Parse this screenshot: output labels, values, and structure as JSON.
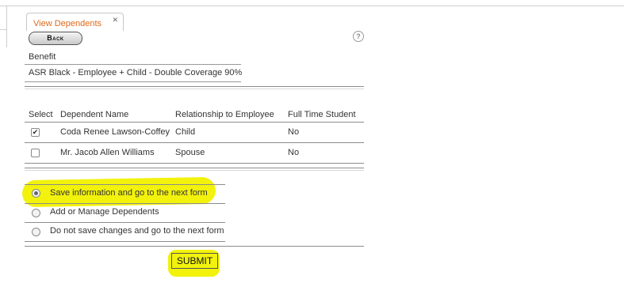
{
  "tab": {
    "label": "View Dependents",
    "close_glyph": "✕"
  },
  "back_label": "Back",
  "help_glyph": "?",
  "benefit": {
    "label": "Benefit",
    "value": "ASR Black - Employee + Child - Double Coverage 90%"
  },
  "dependents_table": {
    "columns": [
      "Select",
      "Dependent Name",
      "Relationship to Employee",
      "Full Time Student"
    ],
    "rows": [
      {
        "checked": true,
        "name": "Coda Renee Lawson-Coffey",
        "relationship": "Child",
        "full_time_student": "No"
      },
      {
        "checked": false,
        "name": "Mr. Jacob Allen Williams",
        "relationship": "Spouse",
        "full_time_student": "No"
      }
    ]
  },
  "options": [
    {
      "label": "Save information and go to the next form",
      "selected": true
    },
    {
      "label": "Add or Manage Dependents",
      "selected": false
    },
    {
      "label": "Do not save changes and go to the next form",
      "selected": false
    }
  ],
  "submit_label": "SUBMIT",
  "colors": {
    "tab_text": "#e0691a",
    "highlight": "#f2f20c"
  }
}
